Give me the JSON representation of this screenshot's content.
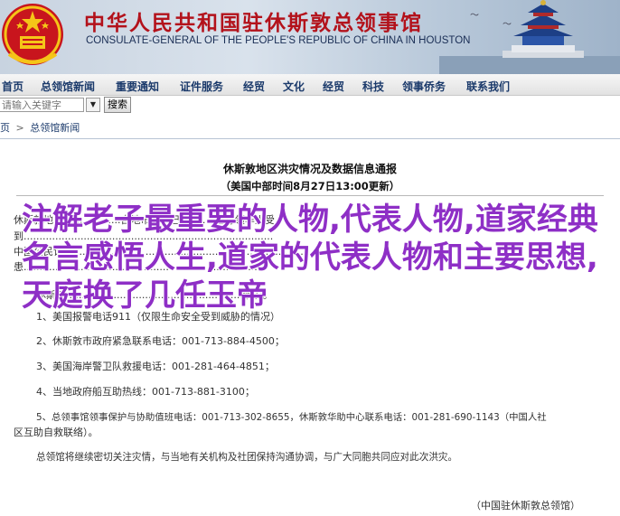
{
  "banner": {
    "title": "中华人民共和国驻休斯敦总领事馆",
    "subtitle": "CONSULATE-GENERAL OF THE PEOPLE'S REPUBLIC OF CHINA IN HOUSTON",
    "emblem_icon": "national-emblem-icon",
    "scene_icon": "temple-of-heaven-icon"
  },
  "nav": {
    "items": [
      "首页",
      "总领馆新闻",
      "重要通知",
      "证件服务",
      "经贸",
      "文化",
      "经贸",
      "科技",
      "领事侨务",
      "联系我们"
    ]
  },
  "search": {
    "placeholder": "请输入关键字",
    "button_label": "搜索"
  },
  "breadcrumb": {
    "home": "页",
    "separator": ">",
    "current": "总领馆新闻"
  },
  "article": {
    "title": "休斯敦地区洪灾情况及数据信息通报",
    "date": "（美国中部时间8月27日13:00更新）",
    "para1_line1": "休斯敦地区遭...............自地市政府已...........位总领华人受",
    "para1_line2": "到...............................................................................",
    "para1_line3": "中国公民请..............................................................................",
    "para1_line4": "患...........................................................................",
    "para2": "休斯敦........................................................情况。",
    "items": [
      "1、美国报警电话911（仅限生命安全受到威胁的情况）",
      "2、休斯敦市政府紧急联系电话：001-713-884-4500；",
      "3、美国海岸警卫队救援电话：001-281-464-4851；",
      "4、当地政府船互助热线：001-713-881-3100；",
      "5、总领事馆领事保护与协助值班电话：001-713-302-8655，休斯敦华助中心联系电话：001-281-690-1143（中国人社",
      "区互助自救联络）。"
    ],
    "closing": "总领馆将继续密切关注灾情，与当地有关机构及社团保持沟通协调，与广大同胞共同应对此次洪灾。",
    "signature": "（中国驻休斯敦总领馆）"
  },
  "overlay": {
    "text": "注解老子最重要的人物,代表人物,道家经典名言感悟人生,道家的代表人物和主要思想,天庭换了几任玉帝"
  },
  "colors": {
    "banner_title": "#b3121b",
    "nav_text": "#1b3a6b",
    "overlay_text": "#8e2fc6"
  }
}
